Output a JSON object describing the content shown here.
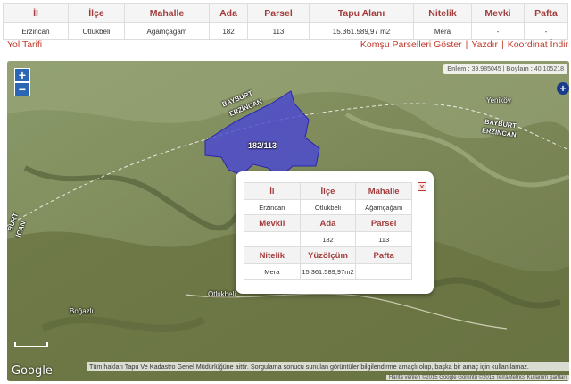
{
  "table": {
    "headers": [
      "İl",
      "İlçe",
      "Mahalle",
      "Ada",
      "Parsel",
      "Tapu Alanı",
      "Nitelik",
      "Mevki",
      "Pafta"
    ],
    "row": [
      "Erzincan",
      "Otlukbeli",
      "Ağamçağam",
      "182",
      "113",
      "15.361.589,97 m2",
      "Mera",
      "-",
      "-"
    ]
  },
  "links": {
    "route": "Yol Tarifi",
    "neighbors": "Komşu Parselleri Göster",
    "print": "Yazdır",
    "coordinate": "Koordinat İndir",
    "separator": "|"
  },
  "map": {
    "coords_prefix_lat": "Enlem :",
    "lat": "39,985045",
    "coords_prefix_lon": "Boylam :",
    "lon": "40,105218",
    "zoom_in": "+",
    "zoom_out": "−",
    "parcel_label": "182/113",
    "labels": {
      "bayburt_top": "BAYBURT",
      "erzincan_top": "ERZİNCAN",
      "bayburt_right": "BAYBURT",
      "erzincan_right": "ERZİNCAN",
      "left_vertical_1": "BURT",
      "left_vertical_2": "İCAN",
      "yenikoy": "Yeniköy",
      "otlukbeli": "Otlukbeli",
      "bogazli": "Boğazlı"
    },
    "google": "Google",
    "disclaimer": "Tüm hakları Tapu Ve Kadastro Genel Müdürlüğüne aittir. Sorgulama sonucu sunulan görüntüler bilgilendirme amaçlı olup, başka bir amaç için kullanılamaz.",
    "attribution": "Harita verileri ©2015 Google Görüntü ©2015 TerraMetrics   Kullanım Şartları",
    "colors": {
      "parcel_fill": "#4a46d6",
      "popup_header": "#a33d3d",
      "link": "#c0392b"
    }
  },
  "popup": {
    "close": "✕",
    "rows": [
      {
        "headers": [
          "İl",
          "İlçe",
          "Mahalle"
        ],
        "values": [
          "Erzincan",
          "Otlukbeli",
          "Ağamçağam"
        ]
      },
      {
        "headers": [
          "Mevkii",
          "Ada",
          "Parsel"
        ],
        "values": [
          "",
          "182",
          "113"
        ]
      },
      {
        "headers": [
          "Nitelik",
          "Yüzölçüm",
          "Pafta"
        ],
        "values": [
          "Mera",
          "15.361.589,97m2",
          ""
        ]
      }
    ]
  }
}
